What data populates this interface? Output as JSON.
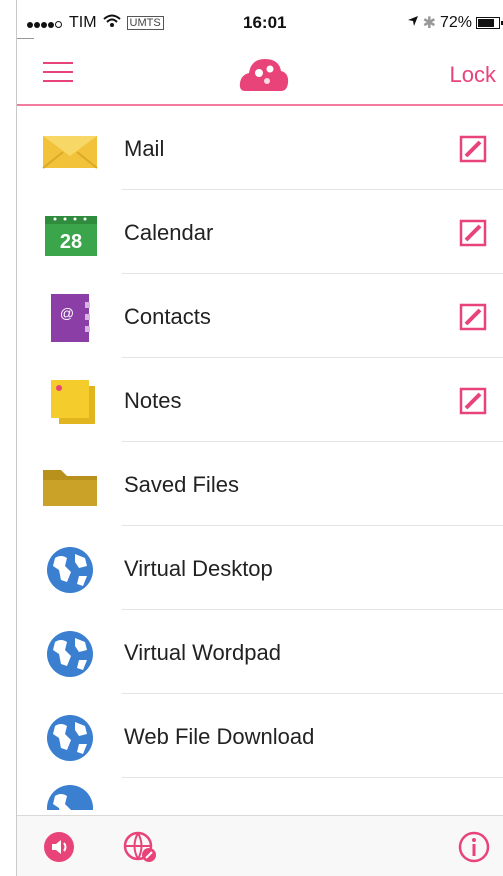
{
  "status_bar": {
    "carrier": "TIM",
    "network": "UMTS",
    "time": "16:01",
    "battery": "72%",
    "battery_level": 0.72
  },
  "nav": {
    "lock_label": "Lock",
    "menu_icon": "hamburger-menu-icon",
    "logo_icon": "app-logo-icon"
  },
  "list": {
    "items": [
      {
        "label": "Mail",
        "icon": "mail-envelope-icon"
      },
      {
        "label": "Calendar",
        "icon": "calendar-icon",
        "calendar_day": "28"
      },
      {
        "label": "Contacts",
        "icon": "contacts-book-icon"
      },
      {
        "label": "Notes",
        "icon": "sticky-notes-icon"
      },
      {
        "label": "Saved Files",
        "icon": "folder-icon"
      },
      {
        "label": "Virtual Desktop",
        "icon": "globe-icon"
      },
      {
        "label": "Virtual Wordpad",
        "icon": "globe-icon"
      },
      {
        "label": "Web File Download",
        "icon": "globe-icon"
      }
    ],
    "edit_icon": "edit-pencil-icon"
  },
  "bottom_bar": {
    "icons": [
      "sound-icon",
      "globe-settings-icon",
      "info-icon"
    ]
  },
  "colors": {
    "accent": "#e8447a",
    "mail": "#f2c23a",
    "calendar_green": "#3aa54a",
    "contacts_purple": "#8b3fa6",
    "notes_yellow": "#f4cc2c",
    "folder": "#c9a227",
    "globe_blue": "#3a7fd0"
  }
}
